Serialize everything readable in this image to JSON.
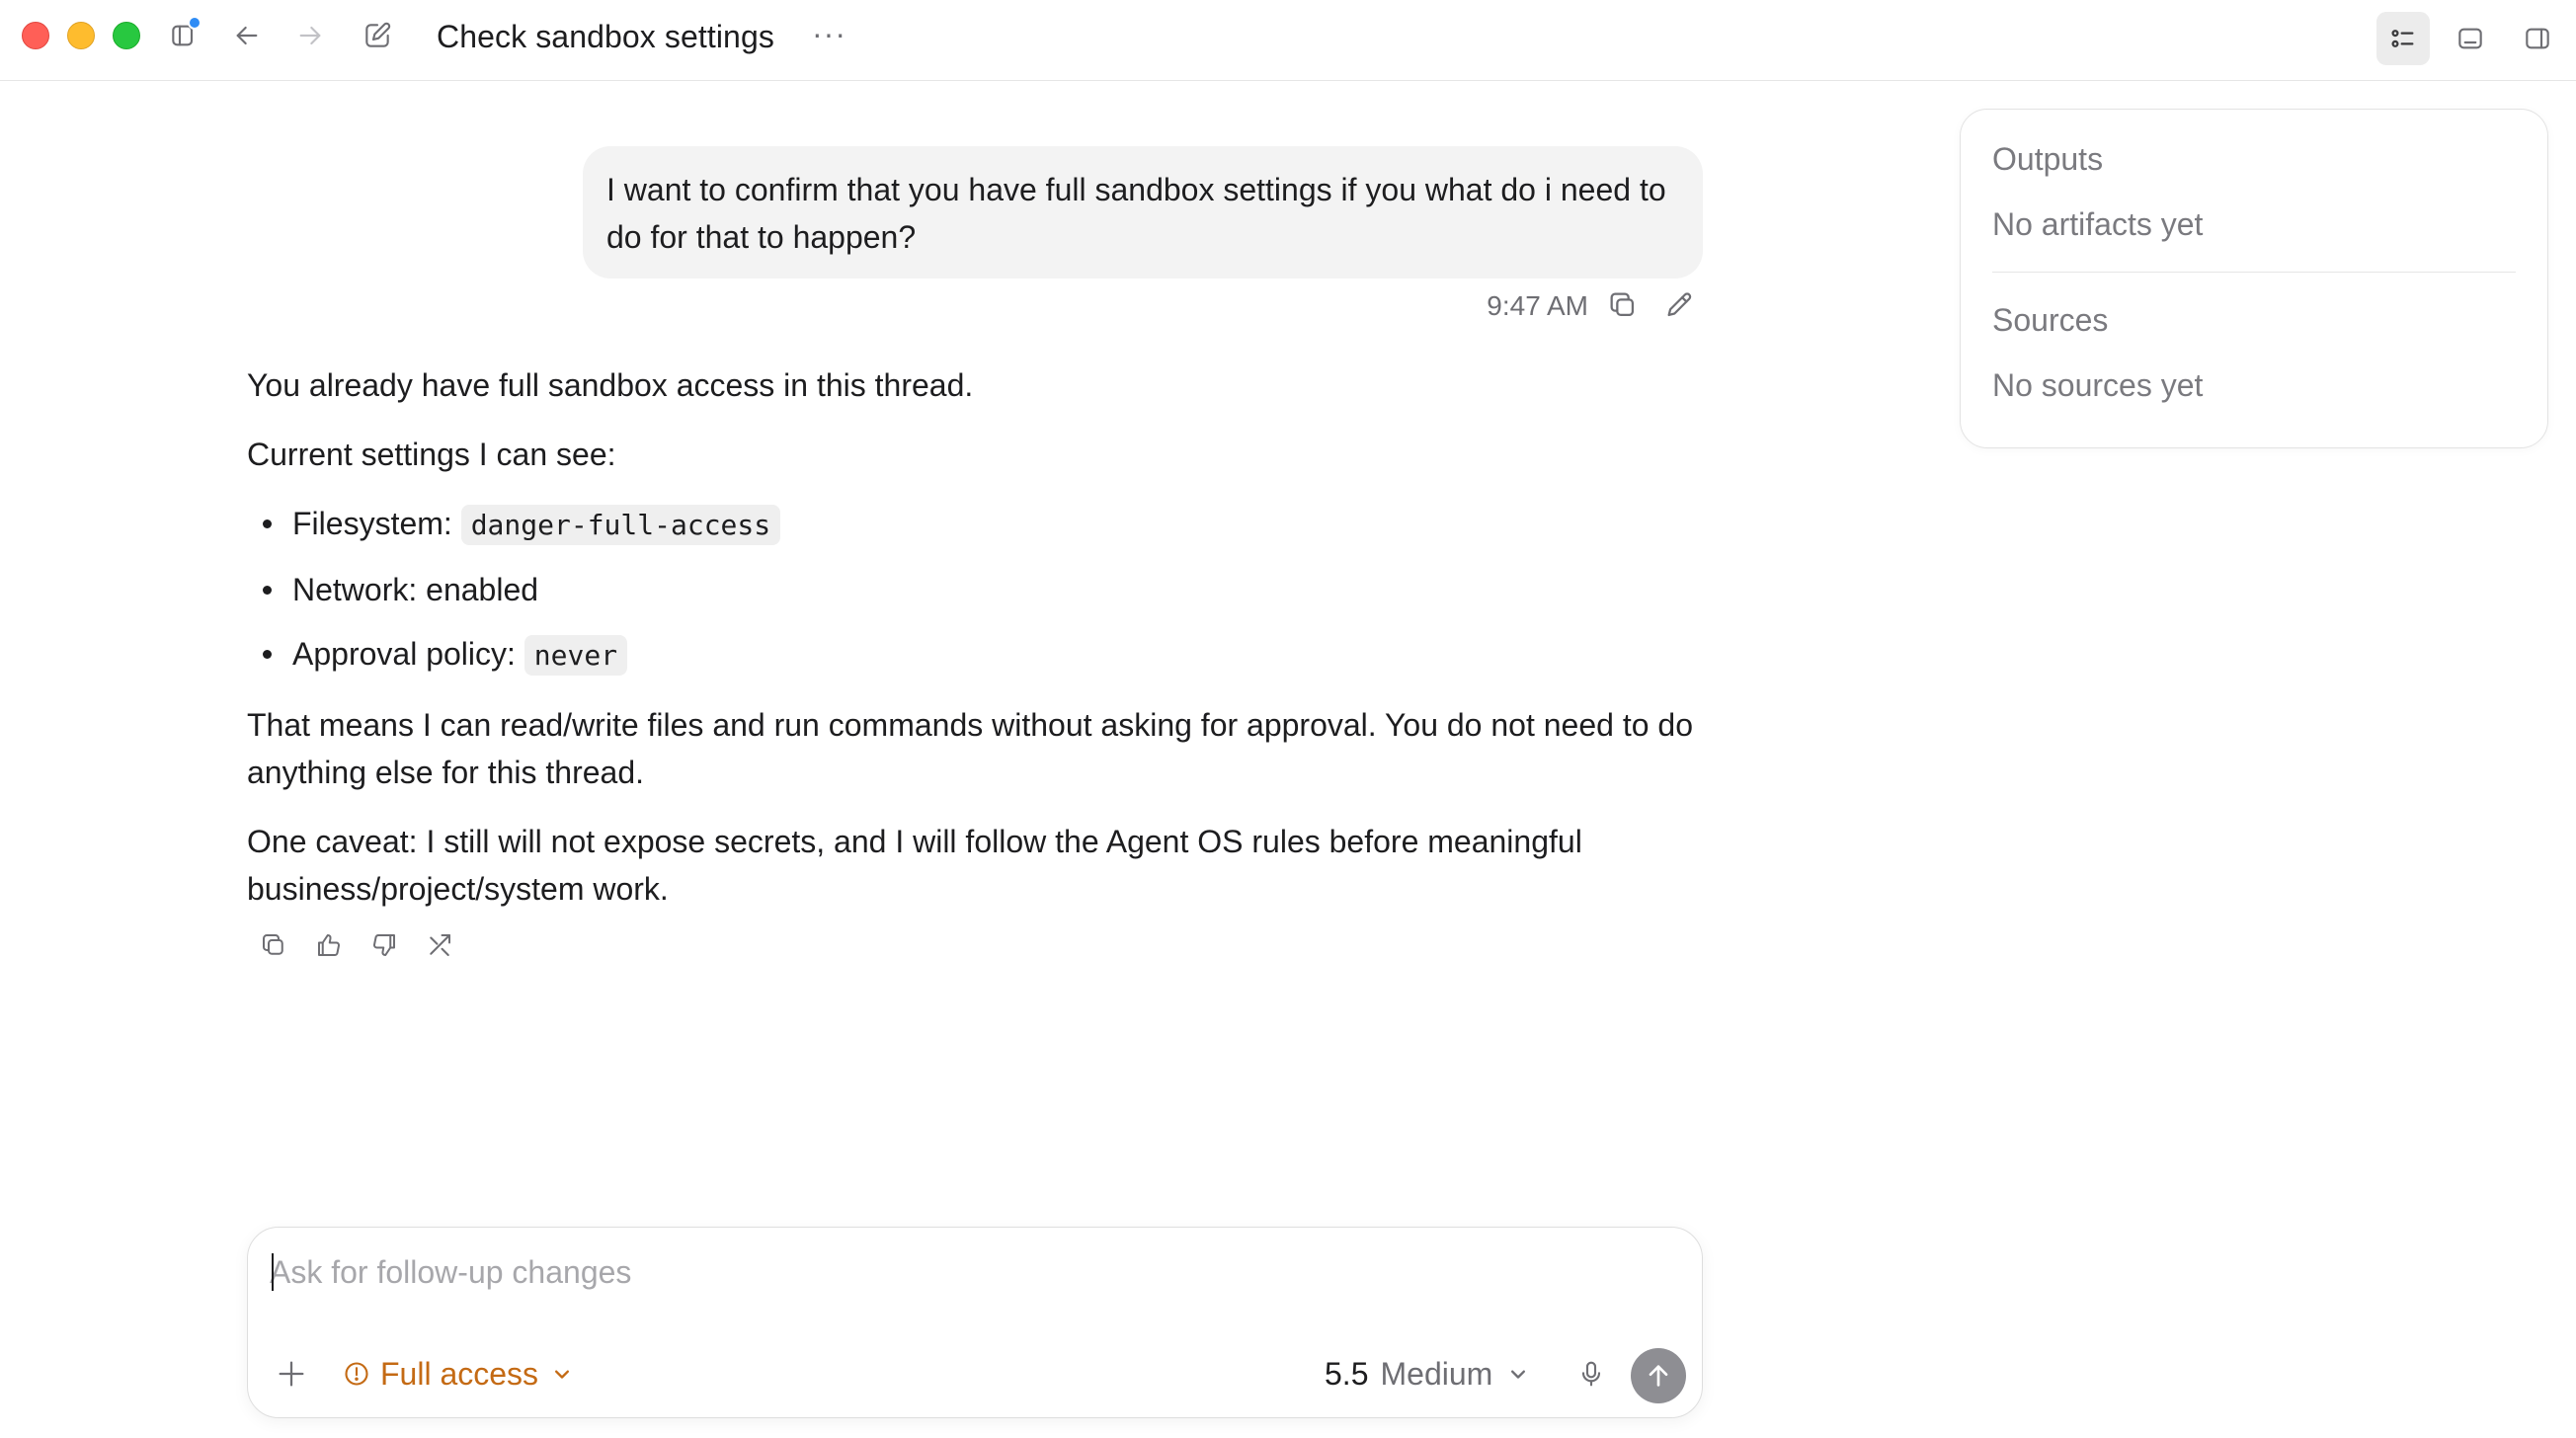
{
  "titlebar": {
    "title": "Check sandbox settings",
    "more_label": "···"
  },
  "user_message": {
    "text": "I want to confirm that you have full sandbox settings if you what do i need to do for that to happen?",
    "timestamp": "9:47 AM"
  },
  "assistant_message": {
    "intro": "You already have full sandbox access in this thread.",
    "settings_heading": "Current settings I can see:",
    "settings": [
      {
        "label": "Filesystem: ",
        "code": "danger-full-access"
      },
      {
        "label": "Network: enabled",
        "code": ""
      },
      {
        "label": "Approval policy: ",
        "code": "never"
      }
    ],
    "paragraph_2": "That means I can read/write files and run commands without asking for approval. You do not need to do anything else for this thread.",
    "paragraph_3": "One caveat: I still will not expose secrets, and I will follow the Agent OS rules before meaningful business/project/system work."
  },
  "side_panel": {
    "outputs_heading": "Outputs",
    "outputs_empty": "No artifacts yet",
    "sources_heading": "Sources",
    "sources_empty": "No sources yet"
  },
  "composer": {
    "placeholder": "Ask for follow-up changes",
    "value": "",
    "access_label": "Full access",
    "model_version": "5.5",
    "model_effort": "Medium"
  },
  "colors": {
    "accent_access": "#c46a14",
    "send_button": "#8e8e93",
    "notification_dot": "#2f8cf5"
  },
  "icons": {
    "titlebar": [
      "sidebar-icon",
      "back-arrow-icon",
      "forward-arrow-icon",
      "compose-icon",
      "more-icon"
    ],
    "right": [
      "outline-panel-icon",
      "bottom-panel-icon",
      "right-panel-icon"
    ],
    "message_actions": [
      "copy-icon",
      "edit-icon"
    ],
    "reactions": [
      "copy-icon",
      "thumbs-up-icon",
      "thumbs-down-icon",
      "share-icon"
    ],
    "composer": [
      "plus-icon",
      "warning-icon",
      "chevron-down-icon",
      "microphone-icon",
      "arrow-up-icon"
    ]
  }
}
